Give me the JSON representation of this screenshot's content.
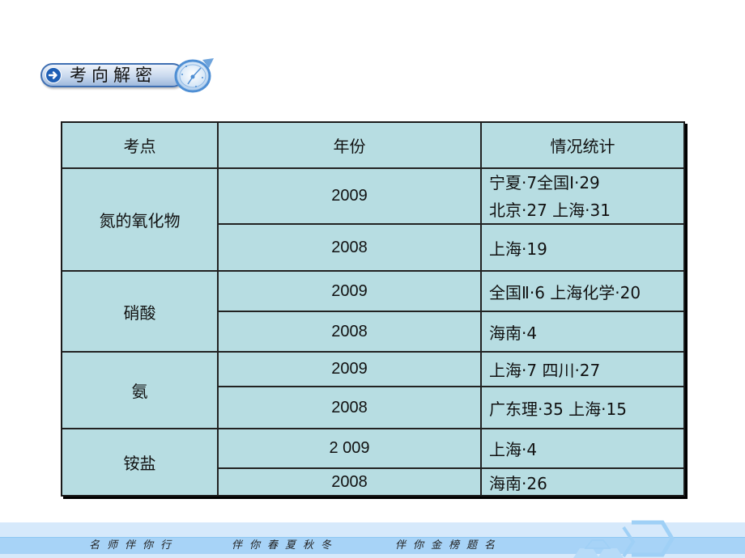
{
  "header": {
    "title": "考向解密",
    "icons": [
      "arrow-right-circle-icon",
      "clock-icon"
    ]
  },
  "table": {
    "headers": [
      "考点",
      "年份",
      "情况统计"
    ],
    "groups": [
      {
        "topic": "氮的氧化物",
        "rows": [
          {
            "year": "2009",
            "stats": [
              "宁夏·7全国Ⅰ·29",
              "北京·27 上海·31"
            ]
          },
          {
            "year": "2008",
            "stats": [
              "上海·19"
            ]
          }
        ]
      },
      {
        "topic": "硝酸",
        "rows": [
          {
            "year": "2009",
            "stats": [
              "全国Ⅱ·6 上海化学·20"
            ]
          },
          {
            "year": "2008",
            "stats": [
              "海南·4"
            ]
          }
        ]
      },
      {
        "topic": "氨",
        "rows": [
          {
            "year": "2009",
            "stats": [
              "上海·7 四川·27"
            ]
          },
          {
            "year": "2008",
            "stats": [
              "广东理·35 上海·15"
            ]
          }
        ]
      },
      {
        "topic": "铵盐",
        "rows": [
          {
            "year": "2 009",
            "stats": [
              "上海·4"
            ]
          },
          {
            "year": "2008",
            "stats": [
              "海南·26"
            ]
          }
        ]
      }
    ]
  },
  "footer": {
    "slogans": [
      "名师伴你行",
      "伴你春夏秋冬",
      "伴你金榜题名"
    ]
  },
  "colors": {
    "table_bg": "#b7dde2",
    "badge_blue": "#1f5fb5",
    "footer_light": "#d6e9fb",
    "footer_stripe": "#a7d3f7"
  }
}
